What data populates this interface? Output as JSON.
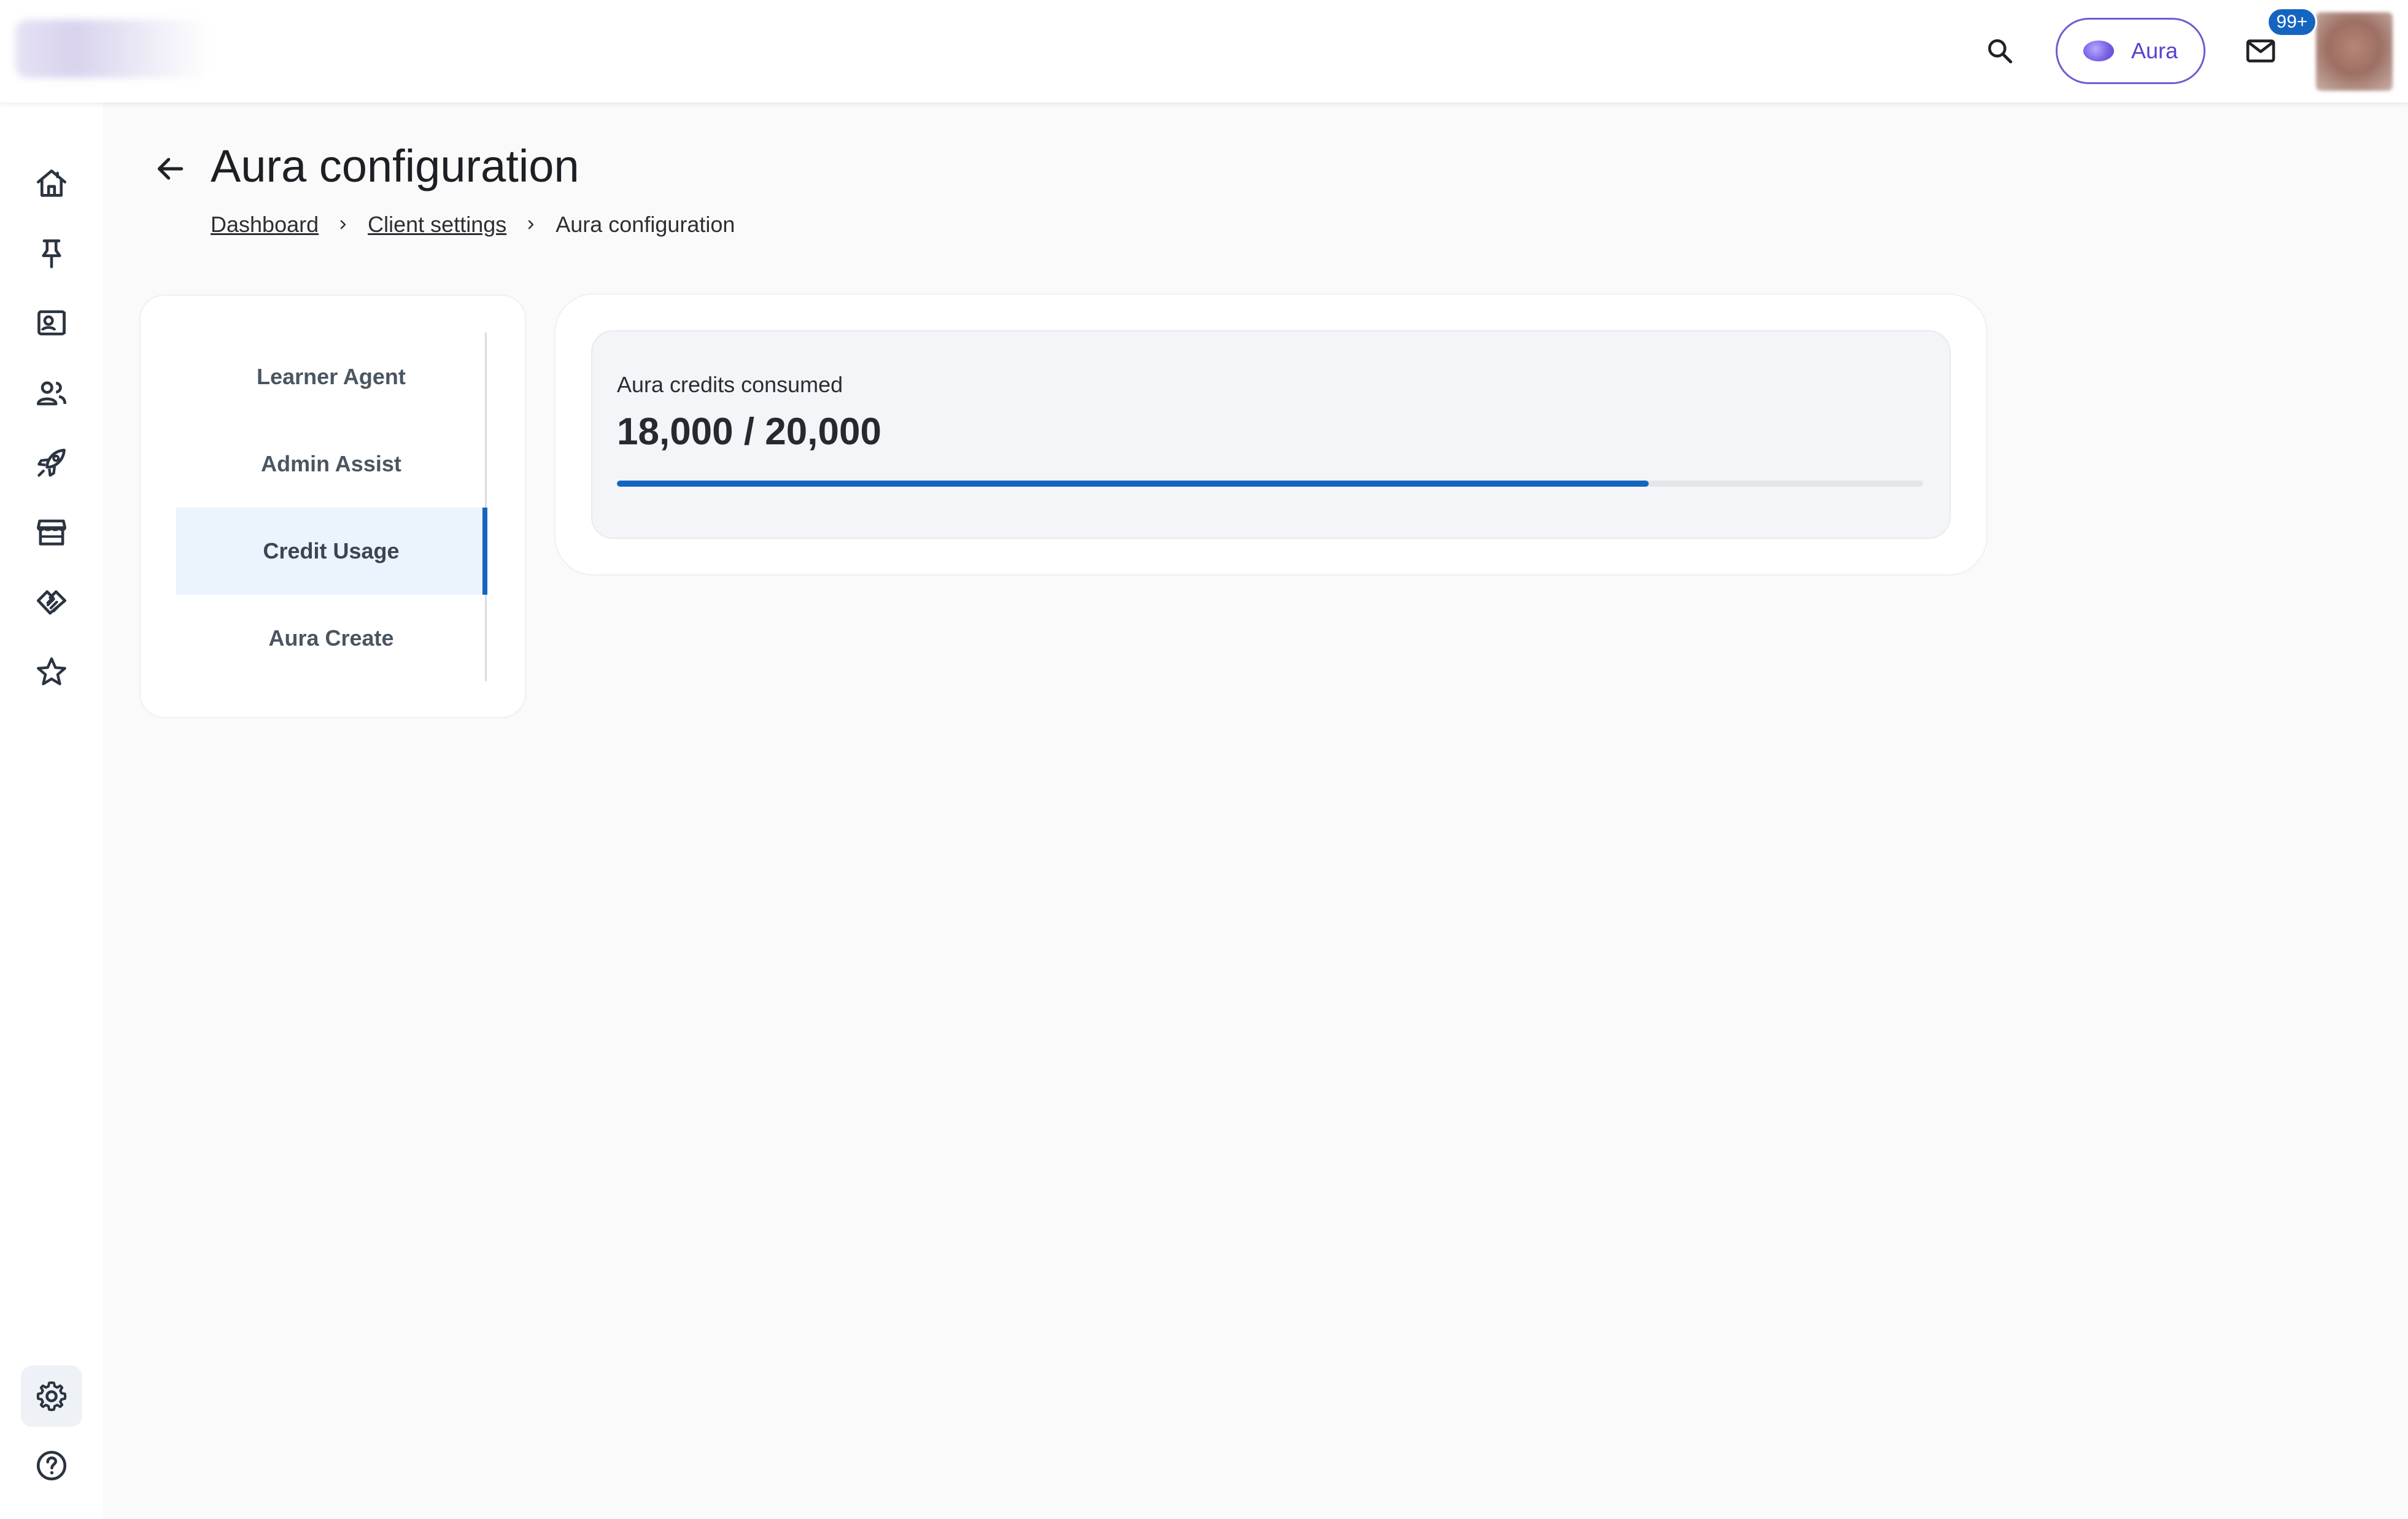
{
  "topbar": {
    "aura_label": "Aura",
    "mail_badge": "99+"
  },
  "rail": {
    "icons": [
      "home-icon",
      "pin-icon",
      "contact-card-icon",
      "people-icon",
      "rocket-icon",
      "store-icon",
      "handshake-icon",
      "star-icon",
      "gear-icon",
      "help-icon"
    ],
    "active": "gear-icon"
  },
  "page": {
    "title": "Aura configuration",
    "breadcrumb": [
      "Dashboard",
      "Client settings",
      "Aura configuration"
    ]
  },
  "settings_nav": {
    "items": [
      "Learner Agent",
      "Admin Assist",
      "Credit Usage",
      "Aura Create"
    ],
    "active_index": 2
  },
  "credits": {
    "label": "Aura credits consumed",
    "value_text": "18,000 / 20,000",
    "consumed": 18000,
    "total": 20000,
    "progress_fraction": 0.79
  },
  "colors": {
    "accent": "#1565c0",
    "aura_purple": "#6f5bd1",
    "active_bg": "#ebf3fd"
  }
}
